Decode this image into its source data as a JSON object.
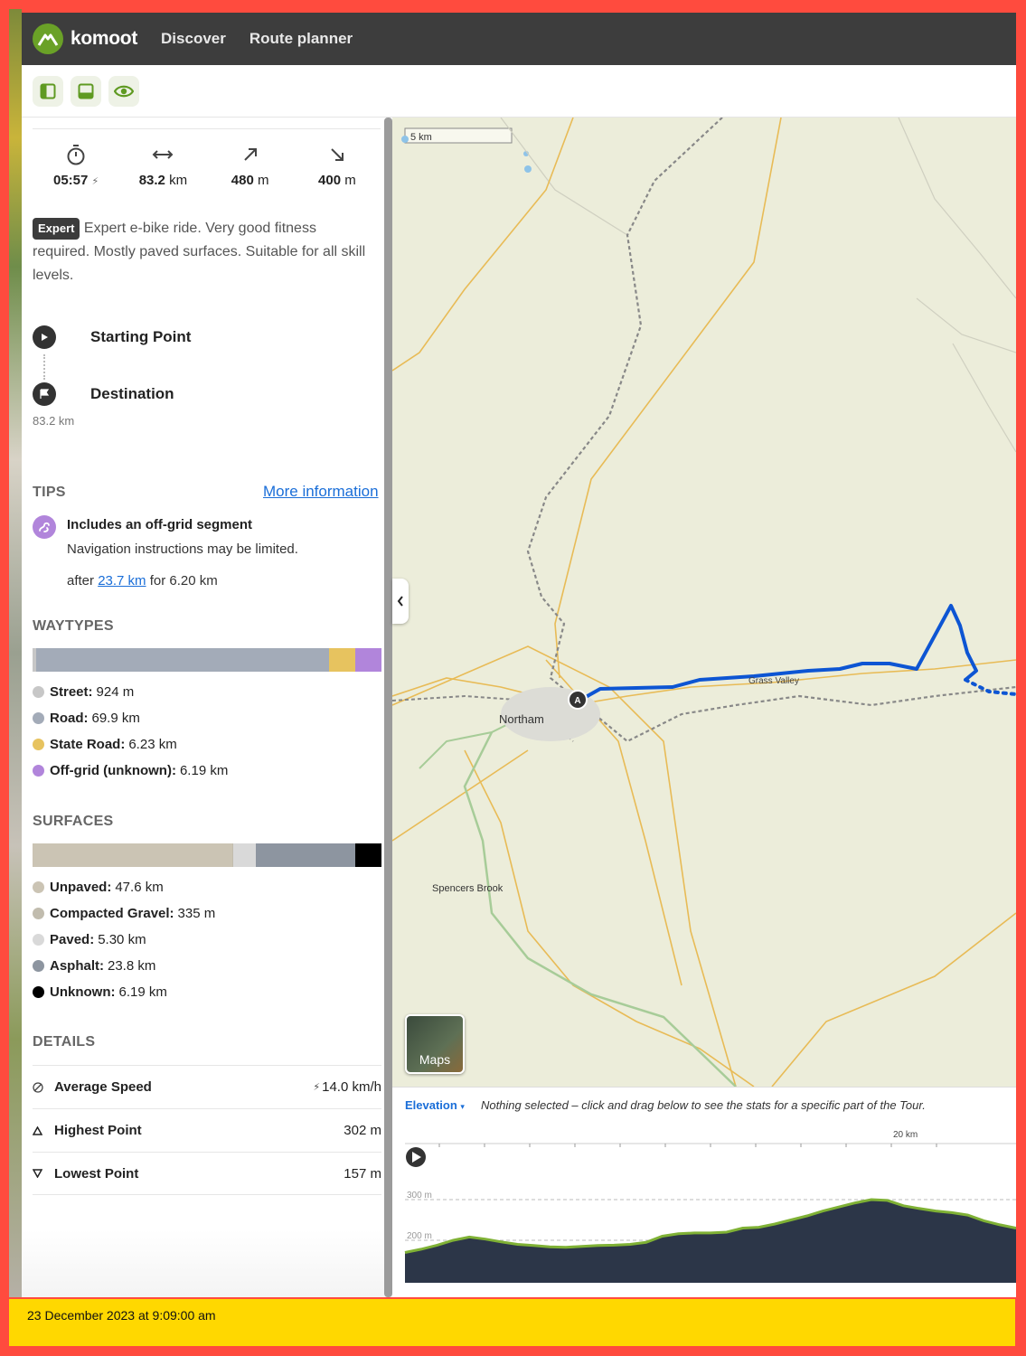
{
  "nav": {
    "brand": "komoot",
    "links": [
      "Discover",
      "Route planner"
    ]
  },
  "stats": {
    "duration": "05:57",
    "distance_value": "83.2",
    "distance_unit": "km",
    "ascent_value": "480",
    "ascent_unit": "m",
    "descent_value": "400",
    "descent_unit": "m"
  },
  "difficulty": {
    "badge": "Expert",
    "text": "Expert e-bike ride. Very good fitness required. Mostly paved surfaces. Suitable for all skill levels."
  },
  "waypoints": {
    "start": "Starting Point",
    "end": "Destination",
    "distance": "83.2 km"
  },
  "tips": {
    "heading": "TIPS",
    "more_info": "More information",
    "title": "Includes an off-grid segment",
    "text": "Navigation instructions may be limited.",
    "after_prefix": "after",
    "after_link": "23.7 km",
    "after_suffix": "for 6.20 km"
  },
  "waytypes": {
    "heading": "WAYTYPES",
    "items": [
      {
        "label": "Street:",
        "value": "924 m",
        "color": "#c7c7c7",
        "share": 0.011
      },
      {
        "label": "Road:",
        "value": "69.9 km",
        "color": "#a3abb8",
        "share": 0.84
      },
      {
        "label": "State Road:",
        "value": "6.23 km",
        "color": "#e7c35f",
        "share": 0.075
      },
      {
        "label": "Off-grid (unknown):",
        "value": "6.19 km",
        "color": "#b185db",
        "share": 0.074
      }
    ]
  },
  "surfaces": {
    "heading": "SURFACES",
    "items": [
      {
        "label": "Unpaved:",
        "value": "47.6 km",
        "color": "#cbc4b4",
        "share": 0.572
      },
      {
        "label": "Compacted Gravel:",
        "value": "335 m",
        "color": "#c1bcae",
        "share": 0.004
      },
      {
        "label": "Paved:",
        "value": "5.30 km",
        "color": "#d9d9d9",
        "share": 0.064
      },
      {
        "label": "Asphalt:",
        "value": "23.8 km",
        "color": "#8d95a0",
        "share": 0.286
      },
      {
        "label": "Unknown:",
        "value": "6.19 km",
        "color": "#000000",
        "share": 0.074
      }
    ]
  },
  "details": {
    "heading": "DETAILS",
    "rows": [
      {
        "label": "Average Speed",
        "value": "14.0 km/h"
      },
      {
        "label": "Highest Point",
        "value": "302 m"
      },
      {
        "label": "Lowest Point",
        "value": "157 m"
      }
    ]
  },
  "map": {
    "scale": "5 km",
    "places": {
      "northam": "Northam",
      "grass_valley": "Grass Valley",
      "spencers_brook": "Spencers Brook"
    },
    "start_marker": "A",
    "layer_button": "Maps"
  },
  "elevation": {
    "tab": "Elevation",
    "hint": "Nothing selected – click and drag below to see the stats for a specific part of the Tour.",
    "km_label": "20 km",
    "y_labels": [
      "300 m",
      "200 m"
    ],
    "profile_m": [
      170,
      178,
      188,
      200,
      208,
      203,
      196,
      190,
      187,
      184,
      183,
      185,
      187,
      188,
      190,
      195,
      210,
      216,
      218,
      218,
      220,
      230,
      232,
      240,
      250,
      260,
      272,
      282,
      292,
      300,
      298,
      285,
      278,
      272,
      268,
      262,
      248,
      238,
      230
    ]
  },
  "timestamp": "23 December 2023 at 9:09:00 am"
}
